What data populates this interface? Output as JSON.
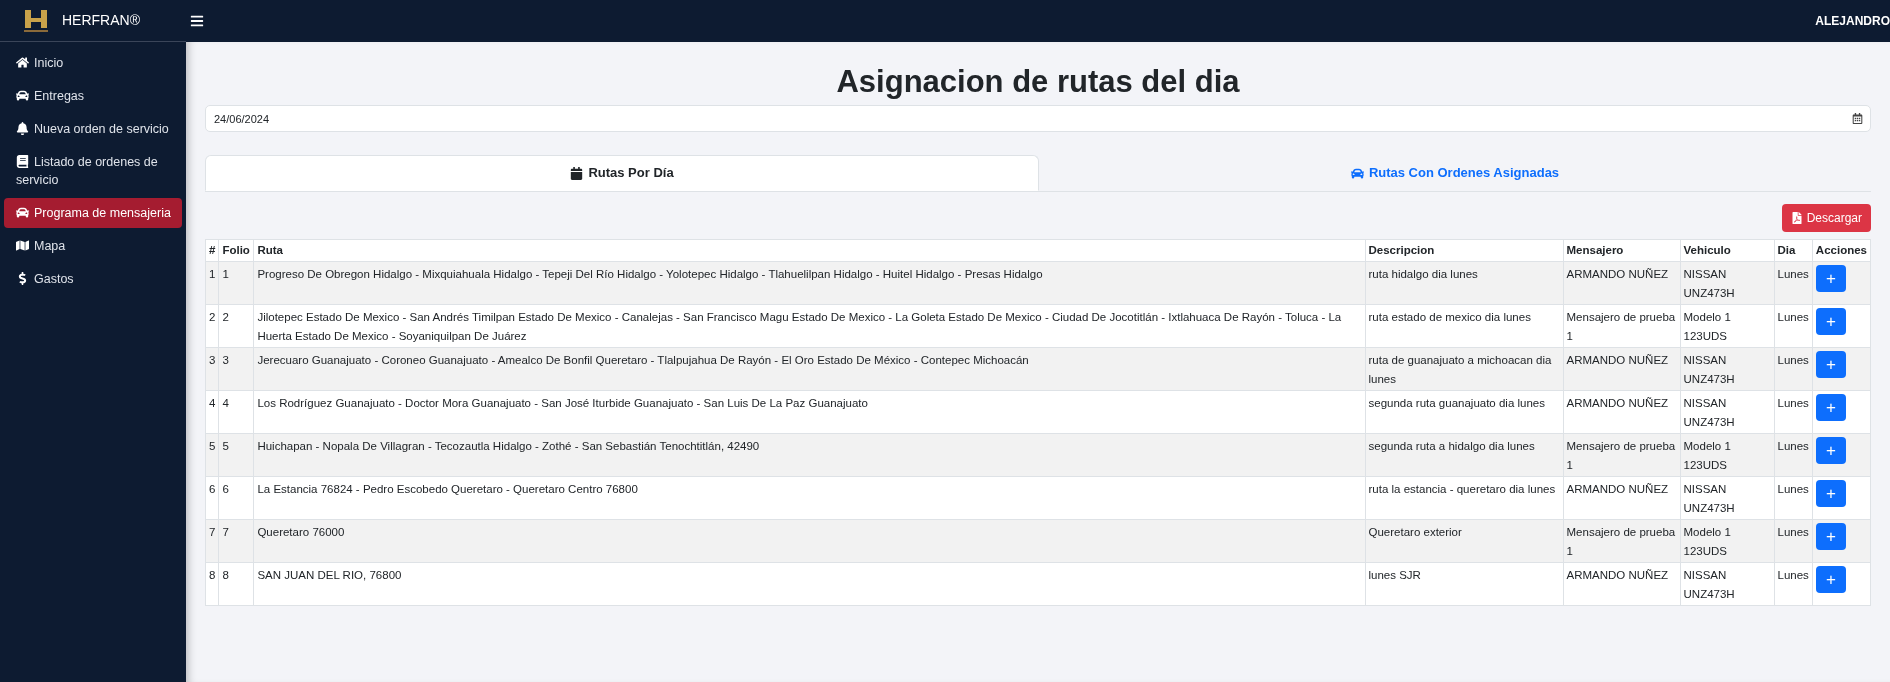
{
  "brand": {
    "name": "HERFRAN®"
  },
  "user": {
    "name": "ALEJANDRO"
  },
  "sidebar": {
    "items": [
      {
        "label": "Inicio",
        "selected": false
      },
      {
        "label": "Entregas",
        "selected": false
      },
      {
        "label": "Nueva orden de servicio",
        "selected": false
      },
      {
        "label": "Listado de ordenes de servicio",
        "selected": false
      },
      {
        "label": "Programa de mensajeria",
        "selected": true
      },
      {
        "label": "Mapa",
        "selected": false
      },
      {
        "label": "Gastos",
        "selected": false
      }
    ]
  },
  "page_title": "Asignacion de rutas del dia",
  "date_field": {
    "value": "24/06/2024"
  },
  "tabs": [
    {
      "label": "Rutas Por Día",
      "selected": true
    },
    {
      "label": "Rutas Con Ordenes Asignadas",
      "selected": false
    }
  ],
  "download_button": {
    "label": "Descargar"
  },
  "table": {
    "columns": [
      "#",
      "Folio",
      "Ruta",
      "Descripcion",
      "Mensajero",
      "Vehiculo",
      "Dia",
      "Acciones"
    ],
    "rows": [
      {
        "n": "1",
        "folio": "1",
        "ruta": "Progreso De Obregon Hidalgo - Mixquiahuala Hidalgo - Tepeji Del Río Hidalgo - Yolotepec Hidalgo - Tlahuelilpan Hidalgo - Huitel Hidalgo - Presas Hidalgo",
        "descripcion": "ruta hidalgo dia lunes",
        "mensajero": "ARMANDO NUÑEZ",
        "vehiculo": "NISSAN UNZ473H",
        "dia": "Lunes",
        "action": "+"
      },
      {
        "n": "2",
        "folio": "2",
        "ruta": "Jilotepec Estado De Mexico - San Andrés Timilpan Estado De Mexico - Canalejas - San Francisco Magu Estado De Mexico - La Goleta Estado De Mexico - Ciudad De Jocotitlán - Ixtlahuaca De Rayón - Toluca - La Huerta Estado De Mexico - Soyaniquilpan De Juárez",
        "descripcion": "ruta estado de mexico dia lunes",
        "mensajero": "Mensajero de prueba 1",
        "vehiculo": "Modelo 1 123UDS",
        "dia": "Lunes",
        "action": "+"
      },
      {
        "n": "3",
        "folio": "3",
        "ruta": "Jerecuaro Guanajuato - Coroneo Guanajuato - Amealco De Bonfil Queretaro - Tlalpujahua De Rayón - El Oro Estado De México - Contepec Michoacán",
        "descripcion": "ruta de guanajuato a michoacan dia lunes",
        "mensajero": "ARMANDO NUÑEZ",
        "vehiculo": "NISSAN UNZ473H",
        "dia": "Lunes",
        "action": "+"
      },
      {
        "n": "4",
        "folio": "4",
        "ruta": "Los Rodríguez Guanajuato - Doctor Mora Guanajuato - San José Iturbide Guanajuato - San Luis De La Paz Guanajuato",
        "descripcion": "segunda ruta guanajuato dia lunes",
        "mensajero": "ARMANDO NUÑEZ",
        "vehiculo": "NISSAN UNZ473H",
        "dia": "Lunes",
        "action": "+"
      },
      {
        "n": "5",
        "folio": "5",
        "ruta": "Huichapan - Nopala De Villagran - Tecozautla Hidalgo - Zothé - San Sebastián Tenochtitlán, 42490",
        "descripcion": "segunda ruta a hidalgo dia lunes",
        "mensajero": "Mensajero de prueba 1",
        "vehiculo": "Modelo 1 123UDS",
        "dia": "Lunes",
        "action": "+"
      },
      {
        "n": "6",
        "folio": "6",
        "ruta": "La Estancia 76824 - Pedro Escobedo Queretaro - Queretaro Centro 76800",
        "descripcion": "ruta la estancia - queretaro dia lunes",
        "mensajero": "ARMANDO NUÑEZ",
        "vehiculo": "NISSAN UNZ473H",
        "dia": "Lunes",
        "action": "+"
      },
      {
        "n": "7",
        "folio": "7",
        "ruta": "Queretaro 76000",
        "descripcion": "Queretaro exterior",
        "mensajero": "Mensajero de prueba 1",
        "vehiculo": "Modelo 1 123UDS",
        "dia": "Lunes",
        "action": "+"
      },
      {
        "n": "8",
        "folio": "8",
        "ruta": "SAN JUAN DEL RIO, 76800",
        "descripcion": "lunes SJR",
        "mensajero": "ARMANDO NUÑEZ",
        "vehiculo": "NISSAN UNZ473H",
        "dia": "Lunes",
        "action": "+"
      }
    ]
  }
}
